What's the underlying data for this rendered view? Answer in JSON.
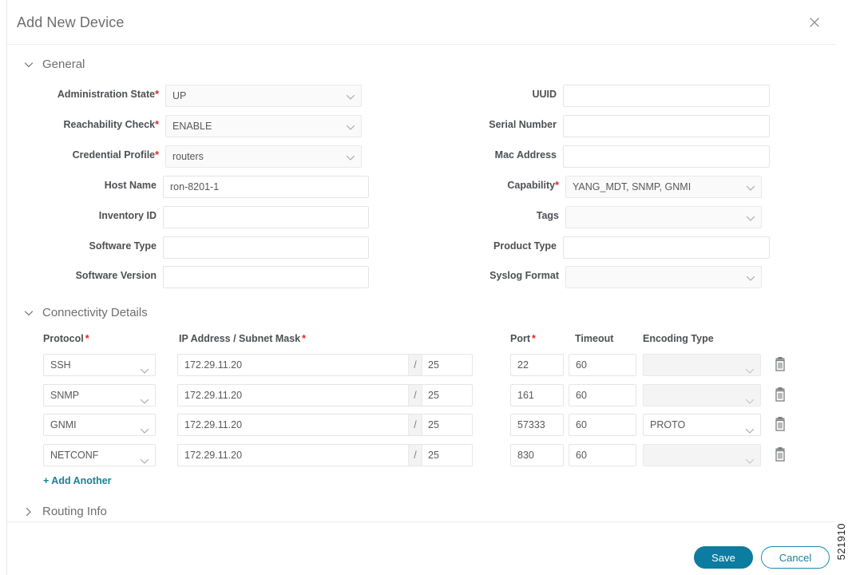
{
  "dialog": {
    "title": "Add New Device",
    "close_icon": "close-icon",
    "figure_id": "521910"
  },
  "sections": {
    "general": {
      "label": "General",
      "expanded": true,
      "chevron": "chevron-down-icon"
    },
    "connectivity": {
      "label": "Connectivity Details",
      "expanded": true,
      "chevron": "chevron-down-icon"
    },
    "routing": {
      "label": "Routing Info",
      "expanded": false,
      "chevron": "chevron-right-icon"
    }
  },
  "general": {
    "left_fields": [
      {
        "label": "Administration State",
        "required": true,
        "type": "select",
        "value": "UP",
        "placeholder": ""
      },
      {
        "label": "Reachability Check",
        "required": true,
        "type": "select",
        "value": "ENABLE",
        "placeholder": ""
      },
      {
        "label": "Credential Profile",
        "required": true,
        "type": "select",
        "value": "routers",
        "placeholder": ""
      },
      {
        "label": "Host Name",
        "required": false,
        "type": "text",
        "value": "ron-8201-1",
        "placeholder": ""
      },
      {
        "label": "Inventory ID",
        "required": false,
        "type": "text",
        "value": "",
        "placeholder": ""
      },
      {
        "label": "Software Type",
        "required": false,
        "type": "text",
        "value": "",
        "placeholder": ""
      },
      {
        "label": "Software Version",
        "required": false,
        "type": "text",
        "value": "",
        "placeholder": ""
      }
    ],
    "right_fields": [
      {
        "label": "UUID",
        "required": false,
        "type": "text",
        "value": "",
        "placeholder": ""
      },
      {
        "label": "Serial Number",
        "required": false,
        "type": "text",
        "value": "",
        "placeholder": ""
      },
      {
        "label": "Mac Address",
        "required": false,
        "type": "text",
        "value": "",
        "placeholder": ""
      },
      {
        "label": "Capability",
        "required": true,
        "type": "select",
        "value": "YANG_MDT, SNMP, GNMI",
        "placeholder": ""
      },
      {
        "label": "Tags",
        "required": false,
        "type": "select",
        "value": "",
        "placeholder": ""
      },
      {
        "label": "Product Type",
        "required": false,
        "type": "text",
        "value": "",
        "placeholder": ""
      },
      {
        "label": "Syslog Format",
        "required": false,
        "type": "select",
        "value": "",
        "placeholder": ""
      }
    ]
  },
  "connectivity": {
    "columns": [
      {
        "label": "Protocol",
        "required": true
      },
      {
        "label": "IP Address / Subnet Mask",
        "required": true
      },
      {
        "label": "Port",
        "required": true
      },
      {
        "label": "Timeout",
        "required": false
      },
      {
        "label": "Encoding Type",
        "required": false
      }
    ],
    "separator": "/",
    "rows": [
      {
        "protocol": "SSH",
        "ip": "172.29.11.20",
        "mask": "25",
        "port": "22",
        "timeout": "60",
        "encoding": "",
        "delete_icon": "trash-icon"
      },
      {
        "protocol": "SNMP",
        "ip": "172.29.11.20",
        "mask": "25",
        "port": "161",
        "timeout": "60",
        "encoding": "",
        "delete_icon": "trash-icon"
      },
      {
        "protocol": "GNMI",
        "ip": "172.29.11.20",
        "mask": "25",
        "port": "57333",
        "timeout": "60",
        "encoding": "PROTO",
        "delete_icon": "trash-icon"
      },
      {
        "protocol": "NETCONF",
        "ip": "172.29.11.20",
        "mask": "25",
        "port": "830",
        "timeout": "60",
        "encoding": "",
        "delete_icon": "trash-icon"
      }
    ],
    "add_another": "+ Add Another"
  },
  "footer": {
    "save_label": "Save",
    "cancel_label": "Cancel"
  },
  "colors": {
    "accent": "#0d7ca1",
    "link": "#1b7e96",
    "required": "#e12325",
    "label": "#4d4f53",
    "border": "#e3e5e6"
  }
}
